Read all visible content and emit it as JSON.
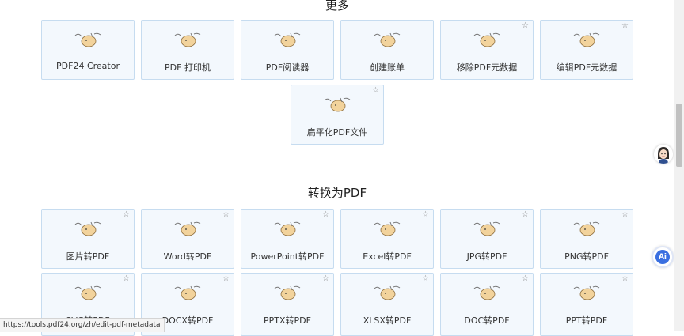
{
  "sections": {
    "more_title": "更多",
    "convert_title": "转换为PDF"
  },
  "more_tools": [
    {
      "label": "PDF24 Creator",
      "starred_icon": false
    },
    {
      "label": "PDF 打印机",
      "starred_icon": false
    },
    {
      "label": "PDF阅读器",
      "starred_icon": false
    },
    {
      "label": "创建账单",
      "starred_icon": false
    },
    {
      "label": "移除PDF元数据",
      "starred_icon": true
    },
    {
      "label": "编辑PDF元数据",
      "starred_icon": true
    },
    {
      "label": "扁平化PDF文件",
      "starred_icon": true
    }
  ],
  "convert_tools": [
    {
      "label": "图片转PDF"
    },
    {
      "label": "Word转PDF"
    },
    {
      "label": "PowerPoint转PDF"
    },
    {
      "label": "Excel转PDF"
    },
    {
      "label": "JPG转PDF"
    },
    {
      "label": "PNG转PDF"
    },
    {
      "label": "SVG转PDF"
    },
    {
      "label": "DOCX转PDF"
    },
    {
      "label": "PPTX转PDF"
    },
    {
      "label": "XLSX转PDF"
    },
    {
      "label": "DOC转PDF"
    },
    {
      "label": "PPT转PDF"
    }
  ],
  "icons": {
    "star": "☆",
    "tool": "mascot-icon",
    "ai": "Ai"
  },
  "status_bar": {
    "url": "https://tools.pdf24.org/zh/edit-pdf-metadata"
  },
  "colors": {
    "card_bg": "#f3f8fd",
    "card_border": "#c6dcf0",
    "ai_blue": "#3a6fe0"
  }
}
